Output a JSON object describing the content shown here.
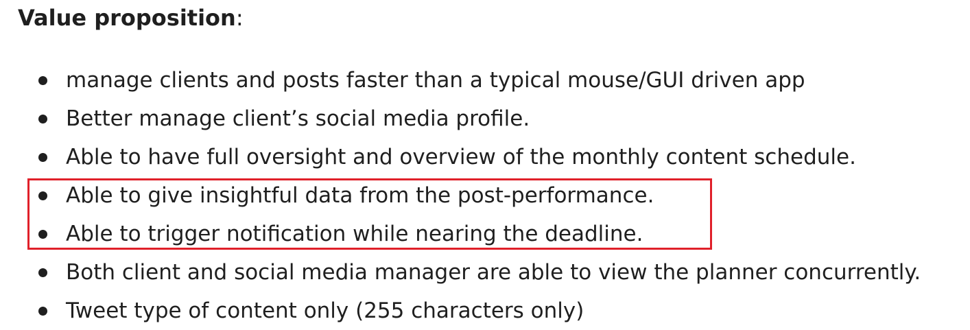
{
  "heading": {
    "label": "Value proposition",
    "suffix": ":"
  },
  "items": [
    "manage clients and posts faster than a typical mouse/GUI driven app",
    "Better manage client’s social media profile.",
    "Able to have full oversight and overview of the monthly content schedule.",
    "Able to give insightful data from the post-performance.",
    "Able to trigger notification while nearing the deadline.",
    "Both client and social media manager are able to view the planner concurrently.",
    "Tweet type of content only (255 characters only)"
  ],
  "highlight": {
    "color": "#e0202a",
    "items_highlighted": [
      4,
      5
    ]
  },
  "colors": {
    "text": "#1f1f1f",
    "background": "#ffffff"
  }
}
